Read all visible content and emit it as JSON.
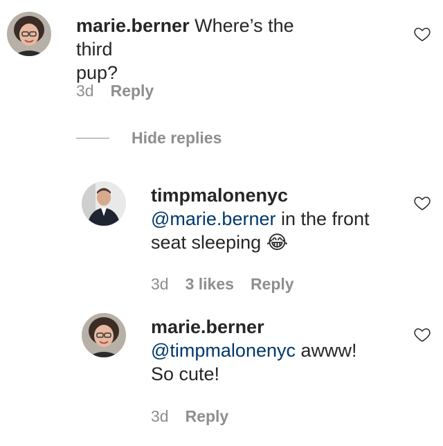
{
  "comments": [
    {
      "username": "marie.berner",
      "text": "Where’s the third",
      "text_line2": "pup?",
      "age": "3d",
      "reply_label": "Reply"
    }
  ],
  "replies_toggle": {
    "label": "Hide replies"
  },
  "replies": [
    {
      "username": "timpmalonenyc",
      "mention": "@marie.berner",
      "text_after_mention": "in the front",
      "text_line2": "seat sleeping",
      "emoji": "😂",
      "age": "3d",
      "likes": "3 likes",
      "reply_label": "Reply"
    },
    {
      "username": "marie.berner",
      "mention": "@timpmalonenyc",
      "text_after_mention": "awww!",
      "text_line2": "So cute!",
      "age": "3d",
      "reply_label": "Reply"
    }
  ],
  "icons": {
    "like": "heart-outline-icon"
  }
}
